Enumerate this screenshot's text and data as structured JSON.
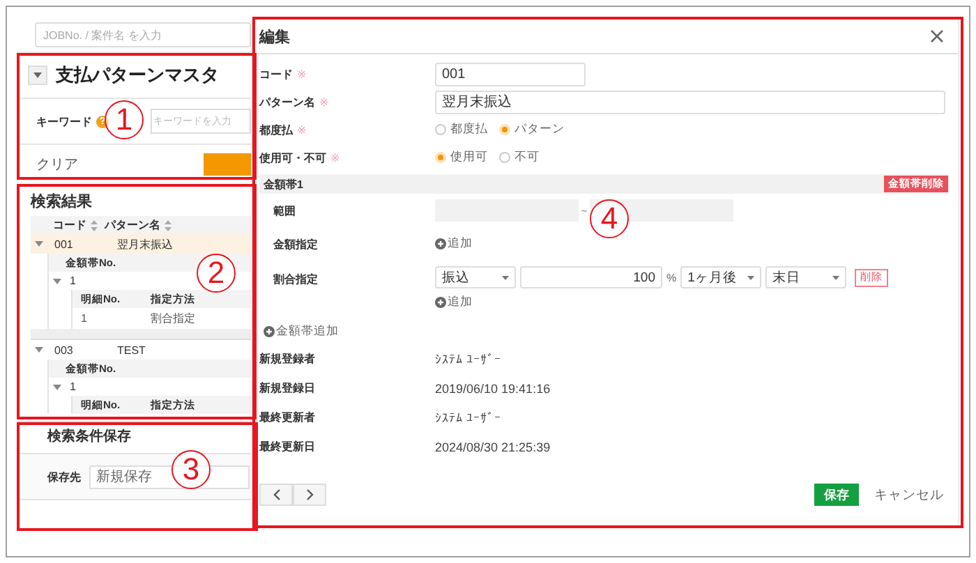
{
  "search": {
    "placeholder": "JOBNo. / 案件名 を入力"
  },
  "panel": {
    "title": "支払パターンマスタ",
    "keyword_label": "キーワード",
    "help": "?",
    "keyword_placeholder": "キーワードを入力",
    "clear": "クリア"
  },
  "results": {
    "title": "検索結果",
    "columns": [
      "コード",
      "パターン名"
    ],
    "rows": [
      {
        "code": "001",
        "name": "翌月末振込",
        "selected": true,
        "expanded": true,
        "band_column": "金額帯No.",
        "bands": [
          {
            "no": "1",
            "expanded": true,
            "detail_columns": [
              "明細No.",
              "指定方法"
            ],
            "details": [
              [
                "1",
                "割合指定"
              ]
            ]
          }
        ]
      },
      {
        "code": "003",
        "name": "TEST",
        "selected": false,
        "expanded": true,
        "band_column": "金額帯No.",
        "bands": [
          {
            "no": "1",
            "expanded": true,
            "detail_columns": [
              "明細No.",
              "指定方法"
            ]
          }
        ]
      }
    ]
  },
  "saved_search": {
    "title": "検索条件保存",
    "label": "保存先",
    "value": "新規保存"
  },
  "modal": {
    "title": "編集",
    "fields": [
      {
        "kind": "short",
        "label": "コード",
        "required": true,
        "value": "001"
      },
      {
        "kind": "text",
        "label": "パターン名",
        "required": true,
        "value": "翌月末振込"
      },
      {
        "kind": "radio",
        "label": "都度払",
        "required": true,
        "options": [
          {
            "label": "都度払",
            "selected": false
          },
          {
            "label": "パターン",
            "selected": true
          }
        ]
      },
      {
        "kind": "radio",
        "label": "使用可・不可",
        "required": true,
        "options": [
          {
            "label": "使用可",
            "selected": true
          },
          {
            "label": "不可",
            "selected": false
          }
        ]
      }
    ],
    "required_mark": "※",
    "band": {
      "title": "金額帯1",
      "delete": "金額帯削除",
      "range_label": "範囲",
      "range_sep": "~",
      "amount_label": "金額指定",
      "amount_add": "追加",
      "ratio_label": "割合指定",
      "ratio": {
        "method": "振込",
        "percent": "100",
        "unit": "%",
        "month": "1ヶ月後",
        "day": "末日",
        "delete": "削除"
      },
      "ratio_add": "追加"
    },
    "add_band": "金額帯追加",
    "info": [
      {
        "label": "新規登録者",
        "value": "ｼｽﾃﾑ ﾕｰｻﾞｰ"
      },
      {
        "label": "新規登録日",
        "value": "2019/06/10 19:41:16"
      },
      {
        "label": "最終更新者",
        "value": "ｼｽﾃﾑ ﾕｰｻﾞｰ"
      },
      {
        "label": "最終更新日",
        "value": "2024/08/30 21:25:39"
      }
    ],
    "footer": {
      "save": "保存",
      "cancel": "キャンセル"
    }
  },
  "annotations": [
    {
      "label": "1"
    },
    {
      "label": "2"
    },
    {
      "label": "3"
    },
    {
      "label": "4"
    }
  ]
}
